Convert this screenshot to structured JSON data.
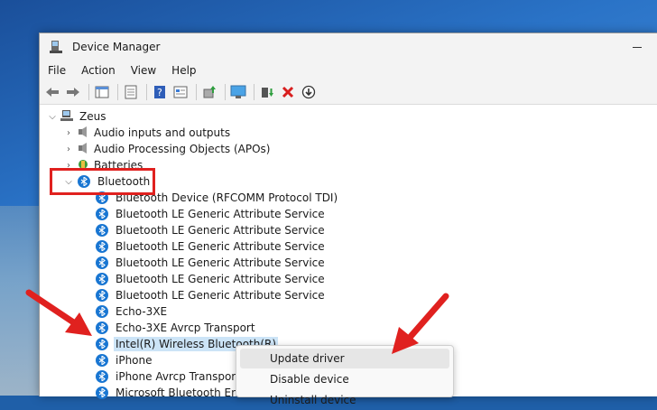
{
  "window": {
    "title": "Device Manager"
  },
  "menu": [
    "File",
    "Action",
    "View",
    "Help"
  ],
  "toolbar": {
    "icons": [
      "back-arrow-icon",
      "forward-arrow-icon",
      "show-hide-tree-icon",
      "properties-icon",
      "help-icon",
      "view-resources-icon",
      "update-driver-icon",
      "scan-hardware-icon",
      "enable-device-icon",
      "uninstall-x-icon",
      "download-icon"
    ]
  },
  "tree": {
    "root": "Zeus",
    "categories": [
      {
        "label": "Audio inputs and outputs",
        "expanded": false
      },
      {
        "label": "Audio Processing Objects (APOs)",
        "expanded": false
      },
      {
        "label": "Batteries",
        "expanded": false
      },
      {
        "label": "Bluetooth",
        "expanded": true
      }
    ],
    "bluetooth_devices": [
      "Bluetooth Device (RFCOMM Protocol TDI)",
      "Bluetooth LE Generic Attribute Service",
      "Bluetooth LE Generic Attribute Service",
      "Bluetooth LE Generic Attribute Service",
      "Bluetooth LE Generic Attribute Service",
      "Bluetooth LE Generic Attribute Service",
      "Bluetooth LE Generic Attribute Service",
      "Echo-3XE",
      "Echo-3XE Avrcp Transport",
      "Intel(R) Wireless Bluetooth(R)",
      "iPhone",
      "iPhone Avrcp Transport",
      "Microsoft Bluetooth Enum"
    ],
    "selected": "Intel(R) Wireless Bluetooth(R)"
  },
  "context_menu": {
    "items": [
      "Update driver",
      "Disable device",
      "Uninstall device"
    ],
    "hovered": "Update driver"
  },
  "colors": {
    "accent": "#1976d2",
    "annotation_red": "#e0211f",
    "selection": "#cce4f7"
  }
}
